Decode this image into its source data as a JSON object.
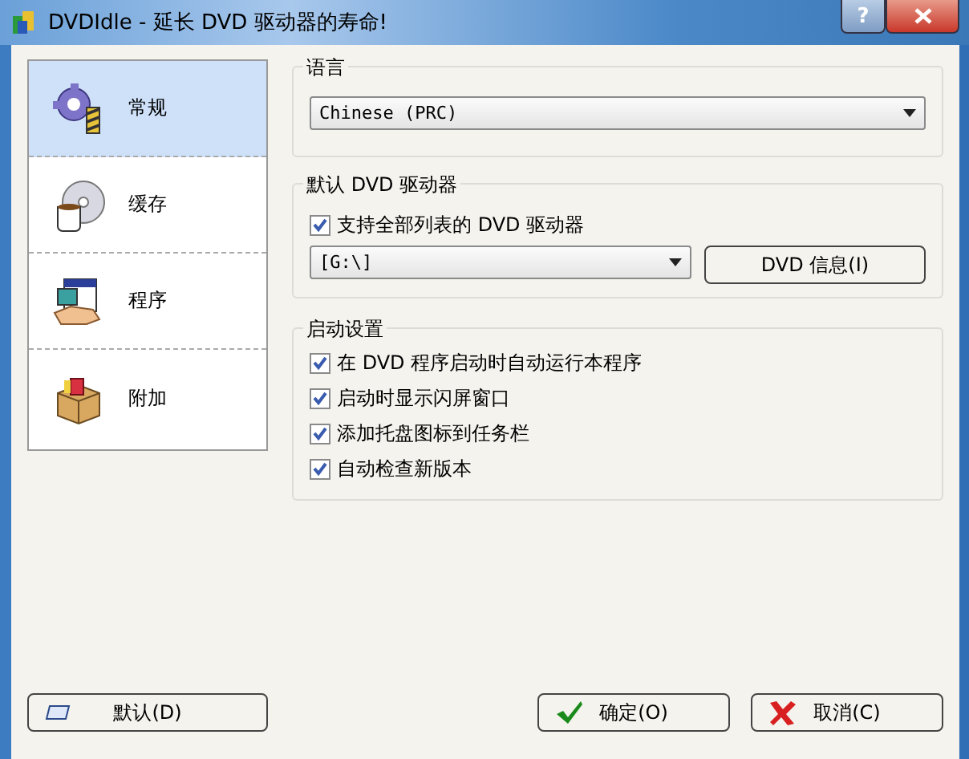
{
  "window": {
    "title": "DVDIdle - 延长 DVD 驱动器的寿命!",
    "help": "?"
  },
  "sidebar": {
    "items": [
      {
        "label": "常规",
        "selected": true
      },
      {
        "label": "缓存",
        "selected": false
      },
      {
        "label": "程序",
        "selected": false
      },
      {
        "label": "附加",
        "selected": false
      }
    ]
  },
  "language": {
    "title": "语言",
    "value": "Chinese (PRC)"
  },
  "drive": {
    "title": "默认 DVD 驱动器",
    "checkbox": {
      "label": "支持全部列表的 DVD 驱动器",
      "checked": true
    },
    "value": "[G:\\]",
    "button": "DVD 信息(I)"
  },
  "startup": {
    "title": "启动设置",
    "options": [
      {
        "label": "在 DVD 程序启动时自动运行本程序",
        "checked": true
      },
      {
        "label": "启动时显示闪屏窗口",
        "checked": true
      },
      {
        "label": "添加托盘图标到任务栏",
        "checked": true
      },
      {
        "label": "自动检查新版本",
        "checked": true
      }
    ]
  },
  "buttons": [
    {
      "kind": "default",
      "label": "默认(D)"
    },
    {
      "kind": "ok",
      "label": "确定(O)"
    },
    {
      "kind": "cancel",
      "label": "取消(C)"
    }
  ]
}
